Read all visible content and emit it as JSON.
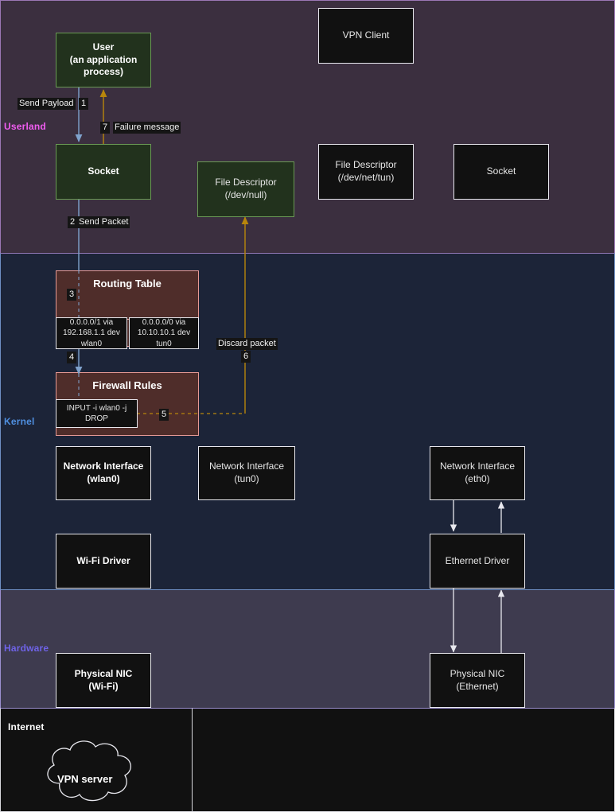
{
  "bands": [
    {
      "id": "userland",
      "label": "Userland",
      "color": "#f05cf0",
      "bg": "#3b2f3f"
    },
    {
      "id": "kernel",
      "label": "Kernel",
      "color": "#4f8fe0",
      "bg": "#1c2438"
    },
    {
      "id": "hardware",
      "label": "Hardware",
      "color": "#6f63e8",
      "bg": "#3e3b4f"
    },
    {
      "id": "internet",
      "label": "Internet",
      "color": "#ffffff",
      "bg": "#111111"
    }
  ],
  "nodes": {
    "user": "User\n(an application process)",
    "user_line1": "User",
    "user_line2": "(an application",
    "user_line3": "process)",
    "vpn_client": "VPN Client",
    "socket_userland": "Socket",
    "fd_devnull_line1": "File Descriptor",
    "fd_devnull_line2": "(/dev/null)",
    "fd_devnettun_line1": "File Descriptor",
    "fd_devnettun_line2": "(/dev/net/tun)",
    "socket_right": "Socket",
    "routing_table_title": "Routing Table",
    "route_wlan0": "0.0.0.0/1 via 192.168.1.1 dev wlan0",
    "route_wlan0_line1": "0.0.0.0/1 via",
    "route_wlan0_line2": "192.168.1.1 dev",
    "route_wlan0_line3": "wlan0",
    "route_tun0": "0.0.0.0/0 via 10.10.10.1 dev tun0",
    "route_tun0_line1": "0.0.0.0/0 via",
    "route_tun0_line2": "10.10.10.1 dev",
    "route_tun0_line3": "tun0",
    "firewall_title": "Firewall Rules",
    "firewall_rule": "INPUT -i wlan0 -j DROP",
    "firewall_rule_line1": "INPUT -i wlan0 -j",
    "firewall_rule_line2": "DROP",
    "nic_wlan0_line1": "Network Interface",
    "nic_wlan0_line2": "(wlan0)",
    "nic_tun0_line1": "Network Interface",
    "nic_tun0_line2": "(tun0)",
    "nic_eth0_line1": "Network Interface",
    "nic_eth0_line2": "(eth0)",
    "wifi_driver": "Wi-Fi Driver",
    "ethernet_driver": "Ethernet Driver",
    "phys_nic_wifi_line1": "Physical NIC",
    "phys_nic_wifi_line2": "(Wi-Fi)",
    "phys_nic_eth_line1": "Physical NIC",
    "phys_nic_eth_line2": "(Ethernet)",
    "vpn_server": "VPN server"
  },
  "edges": [
    {
      "id": "1",
      "number": "1",
      "label": "Send Payload",
      "from": "user",
      "to": "socket_userland",
      "color": "#7fa2cc"
    },
    {
      "id": "2",
      "number": "2",
      "label": "Send Packet",
      "from": "socket_userland",
      "to": "routing_table",
      "color": "#7fa2cc"
    },
    {
      "id": "3",
      "number": "3",
      "label": "",
      "from": "routing_table",
      "to": "route_wlan0",
      "color": "#7fa2cc"
    },
    {
      "id": "4",
      "number": "4",
      "label": "",
      "from": "route_wlan0",
      "to": "firewall_rules",
      "color": "#7fa2cc"
    },
    {
      "id": "5",
      "number": "5",
      "label": "",
      "from": "firewall_rule",
      "to": "discard",
      "color": "#b8860b"
    },
    {
      "id": "6",
      "number": "6",
      "label": "Discard packet",
      "from": "discard",
      "to": "fd_devnull",
      "color": "#b8860b"
    },
    {
      "id": "7",
      "number": "7",
      "label": "Failure message",
      "from": "socket_userland",
      "to": "user",
      "color": "#b8860b"
    }
  ],
  "colors": {
    "arrow_blue": "#7fa2cc",
    "arrow_gold": "#b8860b",
    "green_fill": "#22321d",
    "green_border": "#6a9a55",
    "dark_fill": "#111111",
    "dark_border": "#e8e8ee",
    "maroon_fill": "#4f2d2a",
    "maroon_border": "#e79a95",
    "userland_bg": "#3b2f3f",
    "kernel_bg": "#1c2438",
    "hardware_bg": "#3e3b4f",
    "internet_bg": "#111111"
  }
}
